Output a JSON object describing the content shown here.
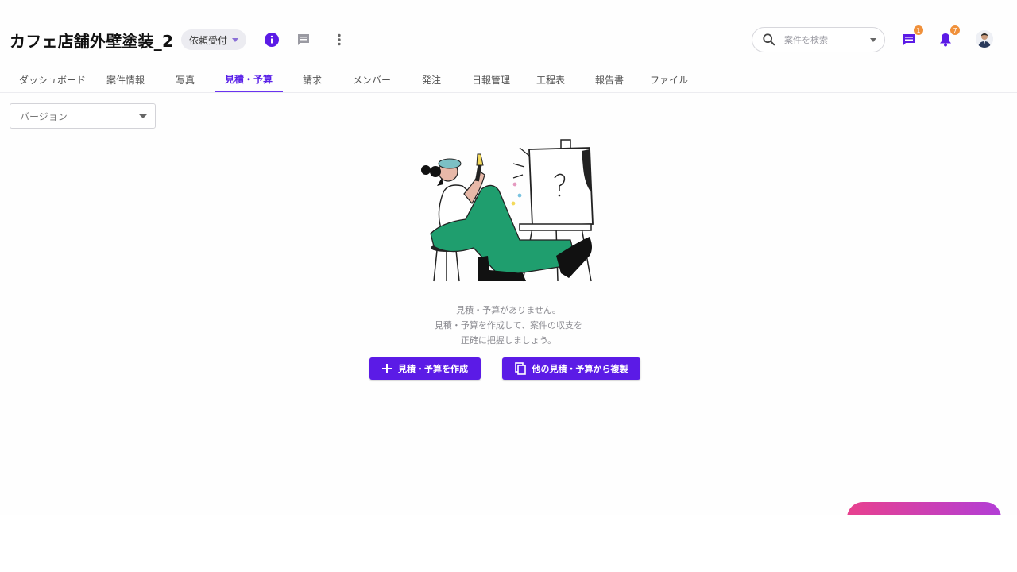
{
  "header": {
    "project_title": "カフェ店舗外壁塗装_2",
    "status_label": "依頼受付",
    "search_placeholder": "案件を検索",
    "chat_badge": "1",
    "notification_badge": "7"
  },
  "tabs": [
    {
      "label": "ダッシュボード"
    },
    {
      "label": "案件情報"
    },
    {
      "label": "写真"
    },
    {
      "label": "見積・予算",
      "active": true
    },
    {
      "label": "請求"
    },
    {
      "label": "メンバー"
    },
    {
      "label": "発注"
    },
    {
      "label": "日報管理"
    },
    {
      "label": "工程表"
    },
    {
      "label": "報告書"
    },
    {
      "label": "ファイル"
    }
  ],
  "version_select": {
    "placeholder": "バージョン"
  },
  "empty_state": {
    "line1": "見積・予算がありません。",
    "line2": "見積・予算を作成して、案件の収支を",
    "line3": "正確に把握しましょう。",
    "create_button": "見積・予算を作成",
    "copy_button": "他の見積・予算から複製"
  },
  "colors": {
    "accent": "#5b1be6",
    "badge": "#f0903a",
    "illustration_green": "#1f9e6e",
    "fab_gradient_start": "#e8418e",
    "fab_gradient_end": "#b23ed6"
  },
  "icons": {
    "info": "info-circle-icon",
    "comment": "comment-icon",
    "more": "more-vertical-icon",
    "search": "search-icon",
    "chat": "chat-icon",
    "bell": "bell-icon",
    "plus": "plus-icon",
    "copy": "copy-icon"
  }
}
